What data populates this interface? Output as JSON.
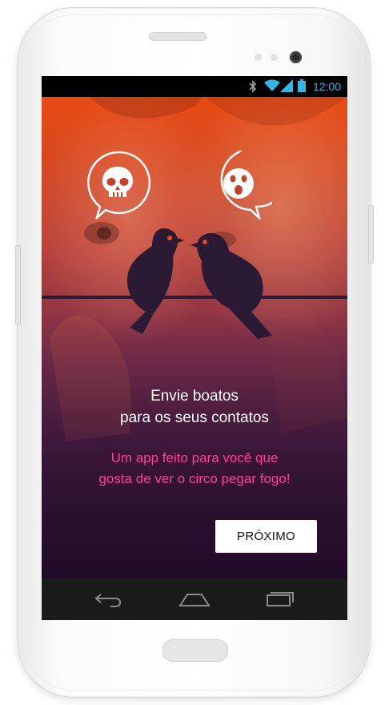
{
  "status_bar": {
    "time": "12:00",
    "icons": [
      "bluetooth-icon",
      "wifi-icon",
      "signal-icon",
      "battery-icon"
    ],
    "icon_color": "#33b5e5"
  },
  "onboarding": {
    "headline_line1": "Envie boatos",
    "headline_line2": "para os seus contatos",
    "subtitle_line1": "Um app feito para você que",
    "subtitle_line2": "gosta de ver o circo pegar fogo!",
    "next_label": "PRÓXIMO",
    "illustration": {
      "left_bubble_icon": "skull-icon",
      "right_bubble_icon": "shocked-face-icon",
      "birds": [
        "bird-icon",
        "bird-icon"
      ]
    }
  },
  "nav_bar": {
    "buttons": [
      "back-icon",
      "home-icon",
      "recent-apps-icon"
    ]
  },
  "colors": {
    "accent_pink": "#ff3f9a",
    "bird_dark": "#2a1a33",
    "bird_eye": "#e84a12",
    "gradient_top": "#e84a12",
    "gradient_bottom": "#2c1032",
    "button_bg": "#ffffff"
  }
}
